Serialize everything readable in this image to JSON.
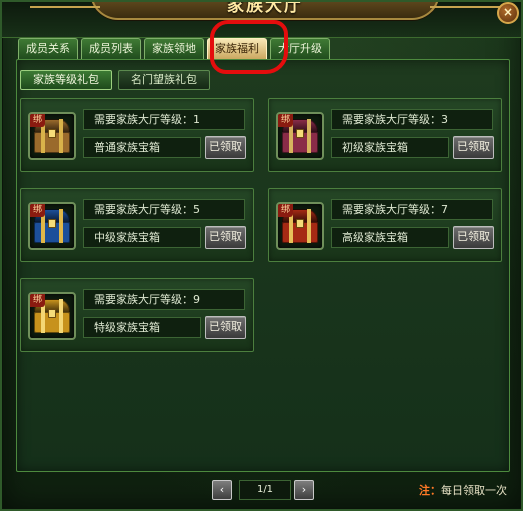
{
  "window": {
    "title": "家族大厅",
    "close_label": "×"
  },
  "tabs": [
    {
      "label": "成员关系",
      "active": false
    },
    {
      "label": "成员列表",
      "active": false
    },
    {
      "label": "家族领地",
      "active": false
    },
    {
      "label": "家族福利",
      "active": true
    },
    {
      "label": "大厅升级",
      "active": false
    }
  ],
  "subtabs": [
    {
      "label": "家族等级礼包",
      "active": true
    },
    {
      "label": "名门望族礼包",
      "active": false
    }
  ],
  "gifts": [
    {
      "requirement": "需要家族大厅等级：1",
      "name": "普通家族宝箱",
      "button": "已领取",
      "bind": "绑",
      "chest_color": "#9a6a2c",
      "band_color": "#d9b24a"
    },
    {
      "requirement": "需要家族大厅等级：3",
      "name": "初级家族宝箱",
      "button": "已领取",
      "bind": "绑",
      "chest_color": "#8a2c48",
      "band_color": "#d6b35e"
    },
    {
      "requirement": "需要家族大厅等级：5",
      "name": "中级家族宝箱",
      "button": "已领取",
      "bind": "绑",
      "chest_color": "#1c4f9a",
      "band_color": "#e1b748"
    },
    {
      "requirement": "需要家族大厅等级：7",
      "name": "高级家族宝箱",
      "button": "已领取",
      "bind": "绑",
      "chest_color": "#a52a14",
      "band_color": "#e7c15a"
    },
    {
      "requirement": "需要家族大厅等级：9",
      "name": "特级家族宝箱",
      "button": "已领取",
      "bind": "绑",
      "chest_color": "#c7921c",
      "band_color": "#f4d774"
    }
  ],
  "pager": {
    "prev": "‹",
    "display": "1/1",
    "next": "›"
  },
  "footer": {
    "note_label": "注：",
    "note_text": "每日领取一次"
  }
}
